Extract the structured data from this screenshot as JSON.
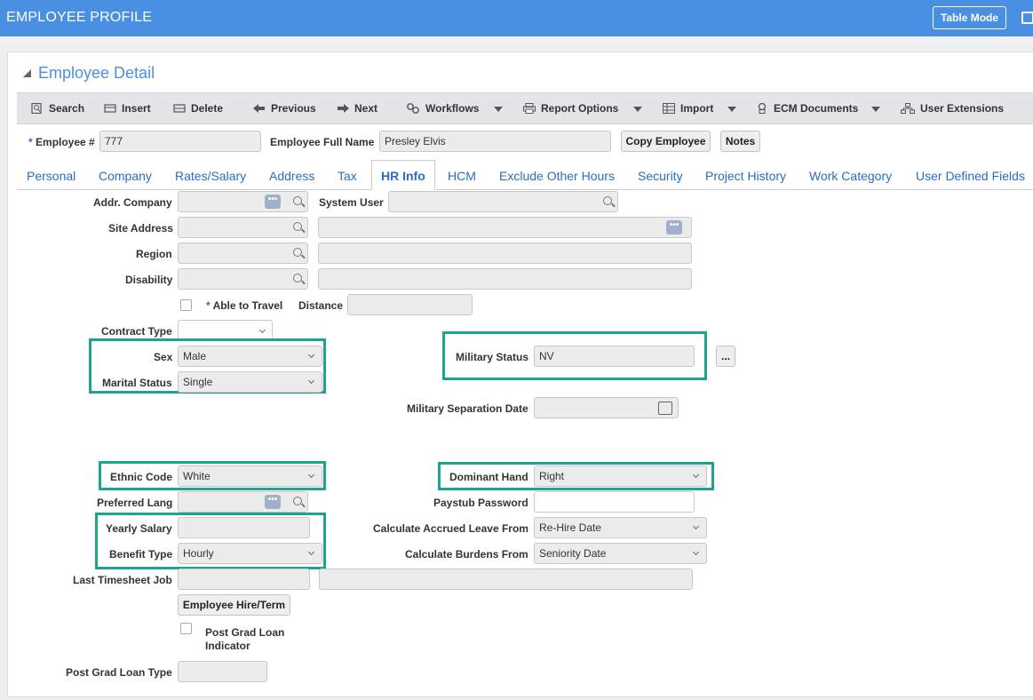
{
  "header": {
    "title": "EMPLOYEE PROFILE",
    "table_mode": "Table Mode"
  },
  "section": {
    "title": "Employee Detail"
  },
  "toolbar": {
    "search": "Search",
    "insert": "Insert",
    "delete": "Delete",
    "previous": "Previous",
    "next": "Next",
    "workflows": "Workflows",
    "report_options": "Report Options",
    "import": "Import",
    "ecm_documents": "ECM Documents",
    "user_extensions": "User Extensions"
  },
  "employee": {
    "number_label": "Employee #",
    "number_value": "777",
    "fullname_label": "Employee Full Name",
    "fullname_value": "Presley Elvis",
    "copy_button": "Copy Employee",
    "notes_button": "Notes"
  },
  "tabs": [
    "Personal",
    "Company",
    "Rates/Salary",
    "Address",
    "Tax",
    "HR Info",
    "HCM",
    "Exclude Other Hours",
    "Security",
    "Project History",
    "Work Category",
    "User Defined Fields"
  ],
  "form": {
    "addr_company": "Addr. Company",
    "system_user": "System User",
    "site_address": "Site Address",
    "region": "Region",
    "disability": "Disability",
    "able_to_travel": "Able to Travel",
    "distance": "Distance",
    "contract_type": "Contract Type",
    "sex": {
      "label": "Sex",
      "value": "Male"
    },
    "marital_status": {
      "label": "Marital Status",
      "value": "Single"
    },
    "military_status": {
      "label": "Military Status",
      "value": "NV",
      "more_button": "..."
    },
    "military_separation_date": "Military Separation Date",
    "ethnic_code": {
      "label": "Ethnic Code",
      "value": "White"
    },
    "dominant_hand": {
      "label": "Dominant Hand",
      "value": "Right"
    },
    "preferred_lang": "Preferred Lang",
    "paystub_password": "Paystub Password",
    "yearly_salary": "Yearly Salary",
    "calc_accrued": {
      "label": "Calculate Accrued Leave From",
      "value": "Re-Hire Date"
    },
    "benefit_type": {
      "label": "Benefit Type",
      "value": "Hourly"
    },
    "calc_burdens": {
      "label": "Calculate Burdens From",
      "value": "Seniority Date"
    },
    "last_timesheet_job": "Last Timesheet Job",
    "hire_term_button": "Employee Hire/Term",
    "post_grad_indicator_1": "Post Grad Loan",
    "post_grad_indicator_2": "Indicator",
    "post_grad_type": "Post Grad Loan Type"
  },
  "colors": {
    "header": "#4a90e2",
    "highlight": "#1aa58c",
    "link": "#2b6cc4"
  }
}
